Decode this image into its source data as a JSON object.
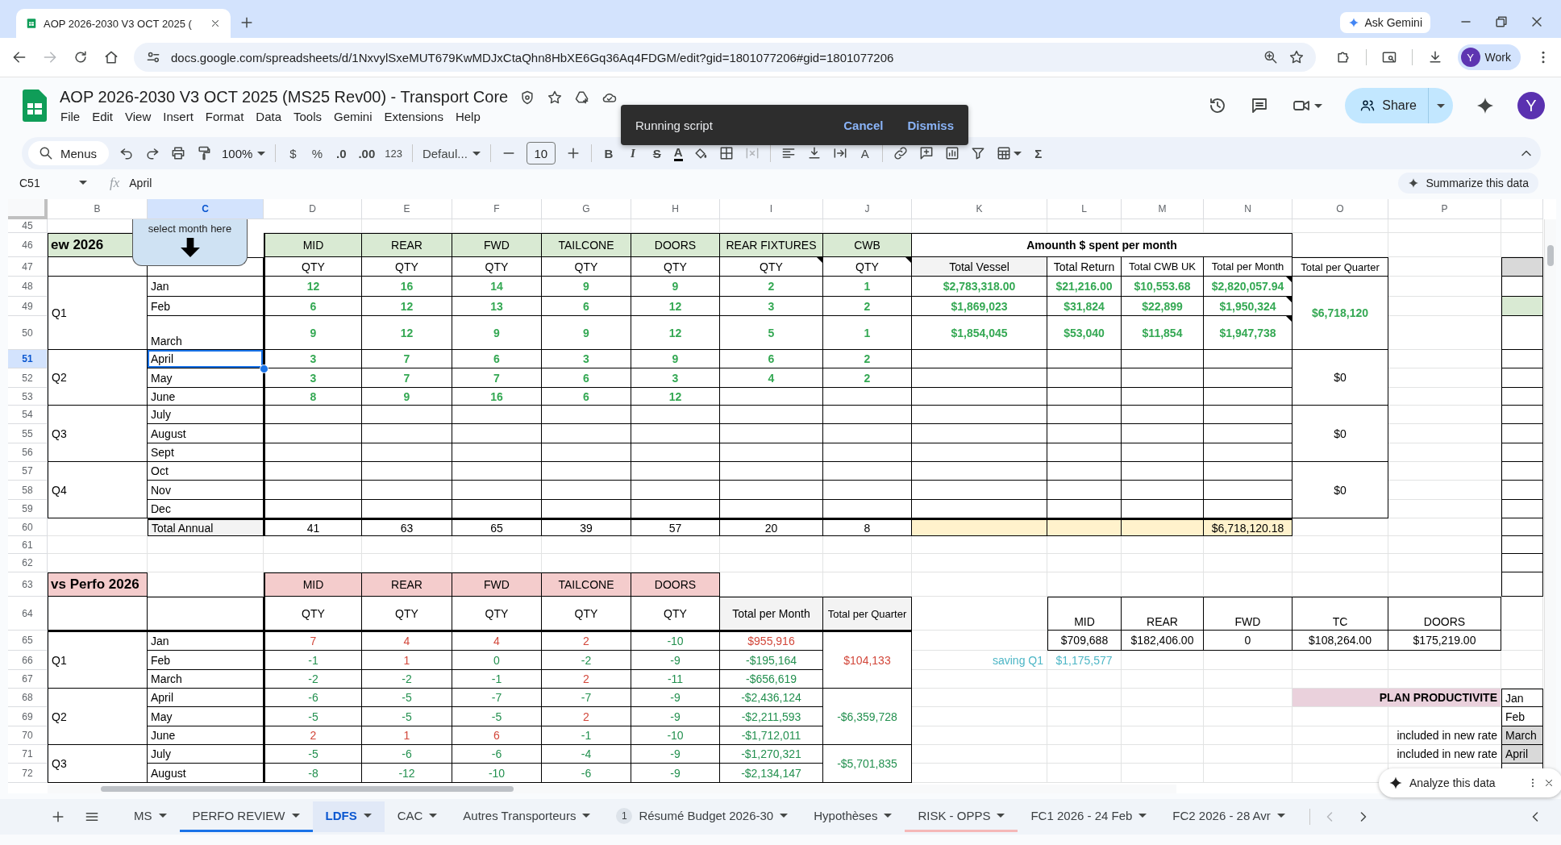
{
  "browser": {
    "tab_title": "AOP 2026-2030 V3 OCT 2025 (",
    "url": "docs.google.com/spreadsheets/d/1NxvylSxeMUT679KwMDJxCtaQhn8HbXE6Gq36Aq4FDGM/edit?gid=1801077206#gid=1801077206",
    "ask_gemini": "Ask Gemini",
    "profile_initial": "Y",
    "profile_label": "Work"
  },
  "document": {
    "title": "AOP 2026-2030 V3 OCT 2025 (MS25 Rev00) - Transport Core",
    "menus": [
      "File",
      "Edit",
      "View",
      "Insert",
      "Format",
      "Data",
      "Tools",
      "Gemini",
      "Extensions",
      "Help"
    ],
    "share": "Share",
    "avatar": "Y"
  },
  "toast": {
    "message": "Running script",
    "actions": [
      "Cancel",
      "Dismiss"
    ]
  },
  "toolbar": {
    "search": "Menus",
    "zoom": "100%",
    "currency": "$",
    "percent": "%",
    "decimals_less": ".0",
    "decimals_more": ".00",
    "number_format": "123",
    "font": "Defaul...",
    "font_size": "10",
    "bold": "B",
    "italic": "I",
    "strikethrough": "S",
    "text_color": "A",
    "rotate": "A",
    "functions": "Σ"
  },
  "formula_bar": {
    "cell_ref": "C51",
    "fx": "fx",
    "value": "April",
    "summarize": "Summarize this data"
  },
  "callout": {
    "text": "select month here"
  },
  "sheet": {
    "columns": [
      {
        "label": "B",
        "selected": false
      },
      {
        "label": "C",
        "selected": true
      },
      {
        "label": "D",
        "selected": false
      },
      {
        "label": "E",
        "selected": false
      },
      {
        "label": "F",
        "selected": false
      },
      {
        "label": "G",
        "selected": false
      },
      {
        "label": "H",
        "selected": false
      },
      {
        "label": "I",
        "selected": false
      },
      {
        "label": "J",
        "selected": false
      },
      {
        "label": "K",
        "selected": false
      },
      {
        "label": "L",
        "selected": false
      },
      {
        "label": "M",
        "selected": false
      },
      {
        "label": "N",
        "selected": false
      },
      {
        "label": "O",
        "selected": false
      },
      {
        "label": "P",
        "selected": false
      }
    ],
    "rows": [
      {
        "label": "45",
        "selected": false
      },
      {
        "label": "46",
        "selected": false,
        "cells": {
          "B": "ew 2026",
          "D": "MID",
          "E": "REAR",
          "F": "FWD",
          "G": "TAILCONE",
          "H": "DOORS",
          "I": "REAR FIXTURES",
          "J": "CWB",
          "K": "Amounth $ spent per month"
        }
      },
      {
        "label": "47",
        "selected": false,
        "cells": {
          "D": "QTY",
          "E": "QTY",
          "F": "QTY",
          "G": "QTY",
          "H": "QTY",
          "I": {
            "text": "QTY",
            "note": true
          },
          "J": {
            "text": "QTY",
            "note": true
          },
          "K": "Total Vessel",
          "L": "Total Return",
          "M": "Total CWB UK",
          "N": "Total per Month",
          "O": "Total per Quarter"
        }
      },
      {
        "label": "48",
        "selected": false,
        "cells": {
          "B": "Q1",
          "C": "Jan",
          "D": {
            "text": "12",
            "color": "#34a853"
          },
          "E": {
            "text": "16",
            "color": "#34a853"
          },
          "F": {
            "text": "14",
            "color": "#34a853"
          },
          "G": {
            "text": "9",
            "color": "#34a853"
          },
          "H": {
            "text": "9",
            "color": "#34a853"
          },
          "I": {
            "text": "2",
            "color": "#34a853"
          },
          "J": {
            "text": "1",
            "color": "#34a853"
          },
          "K": {
            "text": "$2,783,318.00",
            "color": "#34a853"
          },
          "L": {
            "text": "$21,216.00",
            "color": "#34a853"
          },
          "M": {
            "text": "$10,553.68",
            "color": "#34a853"
          },
          "N": {
            "text": "$2,820,057.94",
            "color": "#34a853",
            "note": true
          },
          "O": {
            "text": "$6,718,120",
            "color": "#34a853"
          }
        }
      },
      {
        "label": "49",
        "selected": false,
        "cells": {
          "C": "Feb",
          "D": {
            "text": "6",
            "color": "#34a853"
          },
          "E": {
            "text": "12",
            "color": "#34a853"
          },
          "F": {
            "text": "13",
            "color": "#34a853"
          },
          "G": {
            "text": "6",
            "color": "#34a853"
          },
          "H": {
            "text": "12",
            "color": "#34a853"
          },
          "I": {
            "text": "3",
            "color": "#34a853"
          },
          "J": {
            "text": "2",
            "color": "#34a853"
          },
          "K": {
            "text": "$1,869,023",
            "color": "#34a853"
          },
          "L": {
            "text": "$31,824",
            "color": "#34a853"
          },
          "M": {
            "text": "$22,899",
            "color": "#34a853"
          },
          "N": {
            "text": "$1,950,324",
            "color": "#34a853",
            "note": true
          }
        }
      },
      {
        "label": "50",
        "selected": false,
        "cells": {
          "C": "March",
          "D": {
            "text": "9",
            "color": "#34a853"
          },
          "E": {
            "text": "12",
            "color": "#34a853"
          },
          "F": {
            "text": "9",
            "color": "#34a853"
          },
          "G": {
            "text": "9",
            "color": "#34a853"
          },
          "H": {
            "text": "12",
            "color": "#34a853"
          },
          "I": {
            "text": "5",
            "color": "#34a853"
          },
          "J": {
            "text": "1",
            "color": "#34a853"
          },
          "K": {
            "text": "$1,854,045",
            "color": "#34a853"
          },
          "L": {
            "text": "$53,040",
            "color": "#34a853"
          },
          "M": {
            "text": "$11,854",
            "color": "#34a853"
          },
          "N": {
            "text": "$1,947,738",
            "color": "#34a853",
            "note": true
          }
        }
      },
      {
        "label": "51",
        "selected": true,
        "cells": {
          "B": "Q2",
          "C": {
            "text": "April",
            "selected": true
          },
          "D": {
            "text": "3",
            "color": "#34a853"
          },
          "E": {
            "text": "7",
            "color": "#34a853"
          },
          "F": {
            "text": "6",
            "color": "#34a853"
          },
          "G": {
            "text": "3",
            "color": "#34a853"
          },
          "H": {
            "text": "9",
            "color": "#34a853"
          },
          "I": {
            "text": "6",
            "color": "#34a853"
          },
          "J": {
            "text": "2",
            "color": "#34a853"
          },
          "O": "$0"
        }
      },
      {
        "label": "52",
        "selected": false,
        "cells": {
          "C": "May",
          "D": {
            "text": "3",
            "color": "#34a853"
          },
          "E": {
            "text": "7",
            "color": "#34a853"
          },
          "F": {
            "text": "7",
            "color": "#34a853"
          },
          "G": {
            "text": "6",
            "color": "#34a853"
          },
          "H": {
            "text": "3",
            "color": "#34a853"
          },
          "I": {
            "text": "4",
            "color": "#34a853"
          },
          "J": {
            "text": "2",
            "color": "#34a853"
          }
        }
      },
      {
        "label": "53",
        "selected": false,
        "cells": {
          "C": "June",
          "D": {
            "text": "8",
            "color": "#34a853"
          },
          "E": {
            "text": "9",
            "color": "#34a853"
          },
          "F": {
            "text": "16",
            "color": "#34a853"
          },
          "G": {
            "text": "6",
            "color": "#34a853"
          },
          "H": {
            "text": "12",
            "color": "#34a853"
          }
        }
      },
      {
        "label": "54",
        "selected": false,
        "cells": {
          "B": "Q3",
          "C": "July",
          "O": "$0"
        }
      },
      {
        "label": "55",
        "selected": false,
        "cells": {
          "C": "August"
        }
      },
      {
        "label": "56",
        "selected": false,
        "cells": {
          "C": "Sept"
        }
      },
      {
        "label": "57",
        "selected": false,
        "cells": {
          "B": "Q4",
          "C": "Oct",
          "O": "$0"
        }
      },
      {
        "label": "58",
        "selected": false,
        "cells": {
          "C": "Nov"
        }
      },
      {
        "label": "59",
        "selected": false,
        "cells": {
          "C": "Dec"
        }
      },
      {
        "label": "60",
        "selected": false,
        "cells": {
          "C": "Total Annual",
          "D": "41",
          "E": "63",
          "F": "65",
          "G": "39",
          "H": "57",
          "I": "20",
          "J": "8",
          "N": "$6,718,120.18"
        }
      },
      {
        "label": "61",
        "selected": false
      },
      {
        "label": "62",
        "selected": false
      },
      {
        "label": "63",
        "selected": false,
        "cells": {
          "B": "vs Perfo 2026",
          "D": "MID",
          "E": "REAR",
          "F": "FWD",
          "G": "TAILCONE",
          "H": "DOORS"
        }
      },
      {
        "label": "64",
        "selected": false,
        "cells": {
          "D": "QTY",
          "E": "QTY",
          "F": "QTY",
          "G": "QTY",
          "H": "QTY",
          "I": "Total per Month",
          "J": "Total per Quarter",
          "L": "MID",
          "M": "REAR",
          "N": "FWD",
          "O": "TC",
          "P": "DOORS"
        }
      },
      {
        "label": "65",
        "selected": false,
        "cells": {
          "B": "Q1",
          "C": "Jan",
          "D": {
            "text": "7",
            "color": "#d2473a"
          },
          "E": {
            "text": "4",
            "color": "#d2473a"
          },
          "F": {
            "text": "4",
            "color": "#d2473a"
          },
          "G": {
            "text": "2",
            "color": "#d2473a"
          },
          "H": {
            "text": "-10",
            "color": "#23904f"
          },
          "I": {
            "text": "$955,916",
            "color": "#d2473a"
          },
          "J": {
            "text": "$104,133",
            "color": "#d2473a"
          },
          "L": "$709,688",
          "M": "$182,406.00",
          "N": "0",
          "O": "$108,264.00",
          "P": "$175,219.00"
        }
      },
      {
        "label": "66",
        "selected": false,
        "cells": {
          "C": "Feb",
          "D": {
            "text": "-1",
            "color": "#23904f"
          },
          "E": {
            "text": "1",
            "color": "#d2473a"
          },
          "F": {
            "text": "0",
            "color": "#23904f"
          },
          "G": {
            "text": "-2",
            "color": "#23904f"
          },
          "H": {
            "text": "-9",
            "color": "#23904f"
          },
          "I": {
            "text": "-$195,164",
            "color": "#23904f"
          },
          "K": {
            "text": "saving Q1",
            "color": "#4db6c6"
          },
          "L": {
            "text": "$1,175,577",
            "color": "#4db6c6"
          }
        }
      },
      {
        "label": "67",
        "selected": false,
        "cells": {
          "C": "March",
          "D": {
            "text": "-2",
            "color": "#23904f"
          },
          "E": {
            "text": "-2",
            "color": "#23904f"
          },
          "F": {
            "text": "-1",
            "color": "#23904f"
          },
          "G": {
            "text": "2",
            "color": "#d2473a"
          },
          "H": {
            "text": "-11",
            "color": "#23904f"
          },
          "I": {
            "text": "-$656,619",
            "color": "#23904f"
          }
        }
      },
      {
        "label": "68",
        "selected": false,
        "cells": {
          "B": "Q2",
          "C": "April",
          "D": {
            "text": "-6",
            "color": "#23904f"
          },
          "E": {
            "text": "-5",
            "color": "#23904f"
          },
          "F": {
            "text": "-7",
            "color": "#23904f"
          },
          "G": {
            "text": "-7",
            "color": "#23904f"
          },
          "H": {
            "text": "-9",
            "color": "#23904f"
          },
          "I": {
            "text": "-$2,436,124",
            "color": "#23904f"
          },
          "J": {
            "text": "-$6,359,728",
            "color": "#23904f"
          },
          "O": "PLAN PRODUCTIVITE",
          "Q": "Jan"
        }
      },
      {
        "label": "69",
        "selected": false,
        "cells": {
          "C": "May",
          "D": {
            "text": "-5",
            "color": "#23904f"
          },
          "E": {
            "text": "-5",
            "color": "#23904f"
          },
          "F": {
            "text": "-5",
            "color": "#23904f"
          },
          "G": {
            "text": "2",
            "color": "#d2473a"
          },
          "H": {
            "text": "-9",
            "color": "#23904f"
          },
          "I": {
            "text": "-$2,211,593",
            "color": "#23904f"
          },
          "Q": "Feb"
        }
      },
      {
        "label": "70",
        "selected": false,
        "cells": {
          "C": "June",
          "D": {
            "text": "2",
            "color": "#d2473a"
          },
          "E": {
            "text": "1",
            "color": "#d2473a"
          },
          "F": {
            "text": "6",
            "color": "#d2473a"
          },
          "G": {
            "text": "-1",
            "color": "#23904f"
          },
          "H": {
            "text": "-10",
            "color": "#23904f"
          },
          "I": {
            "text": "-$1,712,011",
            "color": "#23904f"
          },
          "P": "included in new rate",
          "Q": "March"
        }
      },
      {
        "label": "71",
        "selected": false,
        "cells": {
          "B": "Q3",
          "C": "July",
          "D": {
            "text": "-5",
            "color": "#23904f"
          },
          "E": {
            "text": "-6",
            "color": "#23904f"
          },
          "F": {
            "text": "-6",
            "color": "#23904f"
          },
          "G": {
            "text": "-4",
            "color": "#23904f"
          },
          "H": {
            "text": "-9",
            "color": "#23904f"
          },
          "I": {
            "text": "-$1,270,321",
            "color": "#23904f"
          },
          "J": {
            "text": "-$5,701,835",
            "color": "#23904f"
          },
          "P": "included in new rate",
          "Q": "April"
        }
      },
      {
        "label": "72",
        "selected": false,
        "cells": {
          "C": "August",
          "D": {
            "text": "-8",
            "color": "#23904f"
          },
          "E": {
            "text": "-12",
            "color": "#23904f"
          },
          "F": {
            "text": "-10",
            "color": "#23904f"
          },
          "G": {
            "text": "-6",
            "color": "#23904f"
          },
          "H": {
            "text": "-9",
            "color": "#23904f"
          },
          "I": {
            "text": "-$2,134,147",
            "color": "#23904f"
          }
        }
      }
    ]
  },
  "analyze": {
    "label": "Analyze this data"
  },
  "sheet_tabs": [
    {
      "label": "MS",
      "selected": false
    },
    {
      "label": "PERFO REVIEW",
      "selected": false,
      "color": "#1a73e8"
    },
    {
      "label": "LDFS",
      "selected": true
    },
    {
      "label": "CAC",
      "selected": false
    },
    {
      "label": "Autres Transporteurs",
      "selected": false
    },
    {
      "label": "Résumé Budget 2026-30",
      "selected": false,
      "badge": "1"
    },
    {
      "label": "Hypothèses",
      "selected": false
    },
    {
      "label": "RISK - OPPS",
      "selected": false,
      "color": "#f5b8b8"
    },
    {
      "label": "FC1 2026 - 24 Feb",
      "selected": false
    },
    {
      "label": "FC2 2026 - 28 Avr",
      "selected": false
    }
  ]
}
